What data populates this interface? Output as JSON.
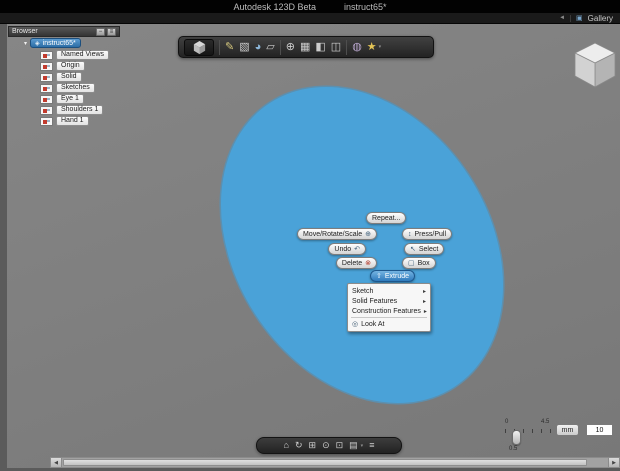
{
  "titlebar": {
    "app_name": "Autodesk 123D Beta",
    "doc_name": "instruct65*"
  },
  "gallery_bar": {
    "label": "Gallery"
  },
  "browser": {
    "title": "Browser",
    "root_label": "instruct65*",
    "items": [
      "Named Views",
      "Origin",
      "Solid",
      "Sketches",
      "Eye 1",
      "Shoulders 1",
      "Hand 1"
    ]
  },
  "marking_menu": {
    "repeat": "Repeat...",
    "move_rotate_scale": "Move/Rotate/Scale",
    "press_pull": "Press/Pull",
    "undo": "Undo",
    "select": "Select",
    "delete": "Delete",
    "box": "Box",
    "extrude": "Extrude",
    "items": [
      {
        "label": "Sketch"
      },
      {
        "label": "Solid Features"
      },
      {
        "label": "Construction Features"
      },
      {
        "label": "Look At"
      }
    ]
  },
  "grid_controls": {
    "ruler_min": "0",
    "ruler_max": "4.5",
    "snap_value": "0.5",
    "units": "mm",
    "grid_size": "10"
  },
  "icons": {
    "back_arrow": "◄",
    "gallery": "▣",
    "panel_minimize": "−",
    "panel_menu": "≡",
    "expander_open": "▾",
    "root_cube": "◈",
    "sketch": "✎",
    "primitive_box": "▧",
    "primitive_sphere": "◕",
    "primitive_cylinder": "▱",
    "move": "⊕",
    "pattern": "▦",
    "combine": "◧",
    "split": "◫",
    "material": "◍",
    "effects": "★",
    "caret_down": "▾",
    "home": "⌂",
    "orbit": "↻",
    "pan": "⊞",
    "zoom": "⊙",
    "fit": "⊡",
    "display_mode": "▤",
    "settings": "≡",
    "undo_arrow": "↶",
    "select_cursor": "↖",
    "delete_x": "⊗",
    "box_outline": "▢",
    "extrude_arrow": "⇧",
    "press_pull_arrows": "↕",
    "move_cross": "⊕",
    "look_at": "◎",
    "submenu_arrow": "▸",
    "scroll_left": "◀",
    "scroll_right": "▶"
  },
  "colors": {
    "ellipse_fill": "#4aa2d8",
    "accent_blue": "#2f7cba"
  }
}
